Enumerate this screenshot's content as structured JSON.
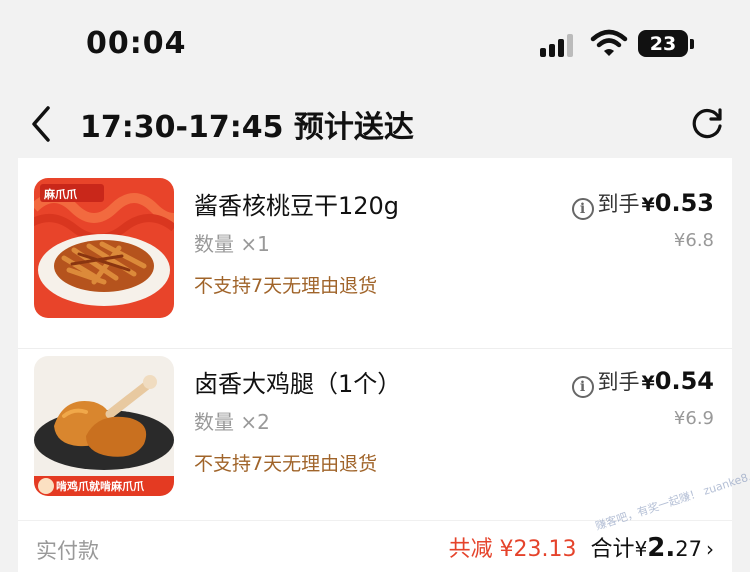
{
  "status_bar": {
    "time": "00:04",
    "battery": "23"
  },
  "header": {
    "title": "17:30-17:45 预计送达"
  },
  "items": [
    {
      "name": "酱香核桃豆干120g",
      "qty": "数量 ×1",
      "policy": "不支持7天无理由退货",
      "price_label": "到手",
      "price_symbol": "¥",
      "price_value": "0.53",
      "original_price": "¥6.8",
      "thumb_brand": "麻爪爪"
    },
    {
      "name": "卤香大鸡腿（1个）",
      "qty": "数量 ×2",
      "policy": "不支持7天无理由退货",
      "price_label": "到手",
      "price_symbol": "¥",
      "price_value": "0.54",
      "original_price": "¥6.9",
      "thumb_banner": "啃鸡爪就啃麻爪爪"
    }
  ],
  "summary": {
    "label": "实付款",
    "discount": "共减 ¥23.13",
    "total_label": "合计",
    "total_symbol": "¥",
    "total_int": "2.",
    "total_dec": "27",
    "chevron": "›"
  },
  "watermark": "赚客吧，有奖一起赚！ zuanke8.com",
  "colors": {
    "accent_red": "#e5432b",
    "policy_brown": "#a0642a",
    "muted": "#999999"
  }
}
